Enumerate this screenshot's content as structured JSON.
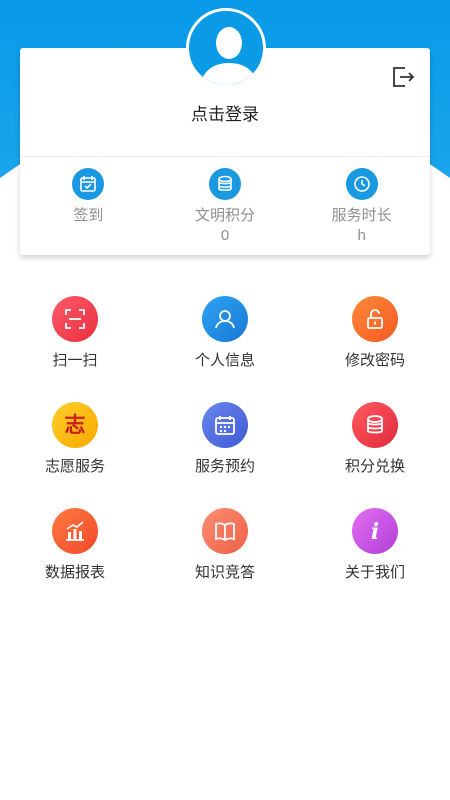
{
  "colors": {
    "header_blue": "#0a9ae6",
    "stat_icon_blue": "#1a98e0",
    "muted_text": "#8f8f8f",
    "body_text": "#333333"
  },
  "profile": {
    "login_prompt": "点击登录",
    "avatar_icon": "user-silhouette-icon",
    "logout_icon": "logout-icon"
  },
  "stats": [
    {
      "label": "签到",
      "value": "",
      "icon": "calendar-check-icon"
    },
    {
      "label": "文明积分",
      "value": "0",
      "icon": "coin-stack-icon"
    },
    {
      "label": "服务时长",
      "value": "h",
      "icon": "clock-icon"
    }
  ],
  "menu": [
    {
      "label": "扫一扫",
      "icon": "scan-icon",
      "color": "#ef3e4a"
    },
    {
      "label": "个人信息",
      "icon": "user-icon",
      "color": "#1e8fe0"
    },
    {
      "label": "修改密码",
      "icon": "lock-icon",
      "color": "#ff6a2c"
    },
    {
      "label": "志愿服务",
      "icon": "volunteer-icon",
      "color": "#f7b500"
    },
    {
      "label": "服务预约",
      "icon": "calendar-icon",
      "color": "#4e6fe0"
    },
    {
      "label": "积分兑换",
      "icon": "coins-icon",
      "color": "#ef3a4a"
    },
    {
      "label": "数据报表",
      "icon": "bar-chart-icon",
      "color": "#fa5a34"
    },
    {
      "label": "知识竞答",
      "icon": "book-icon",
      "color": "#f4765a"
    },
    {
      "label": "关于我们",
      "icon": "info-icon",
      "color": "#c44ee0"
    }
  ],
  "volunteer_glyph": "志",
  "info_glyph": "i"
}
